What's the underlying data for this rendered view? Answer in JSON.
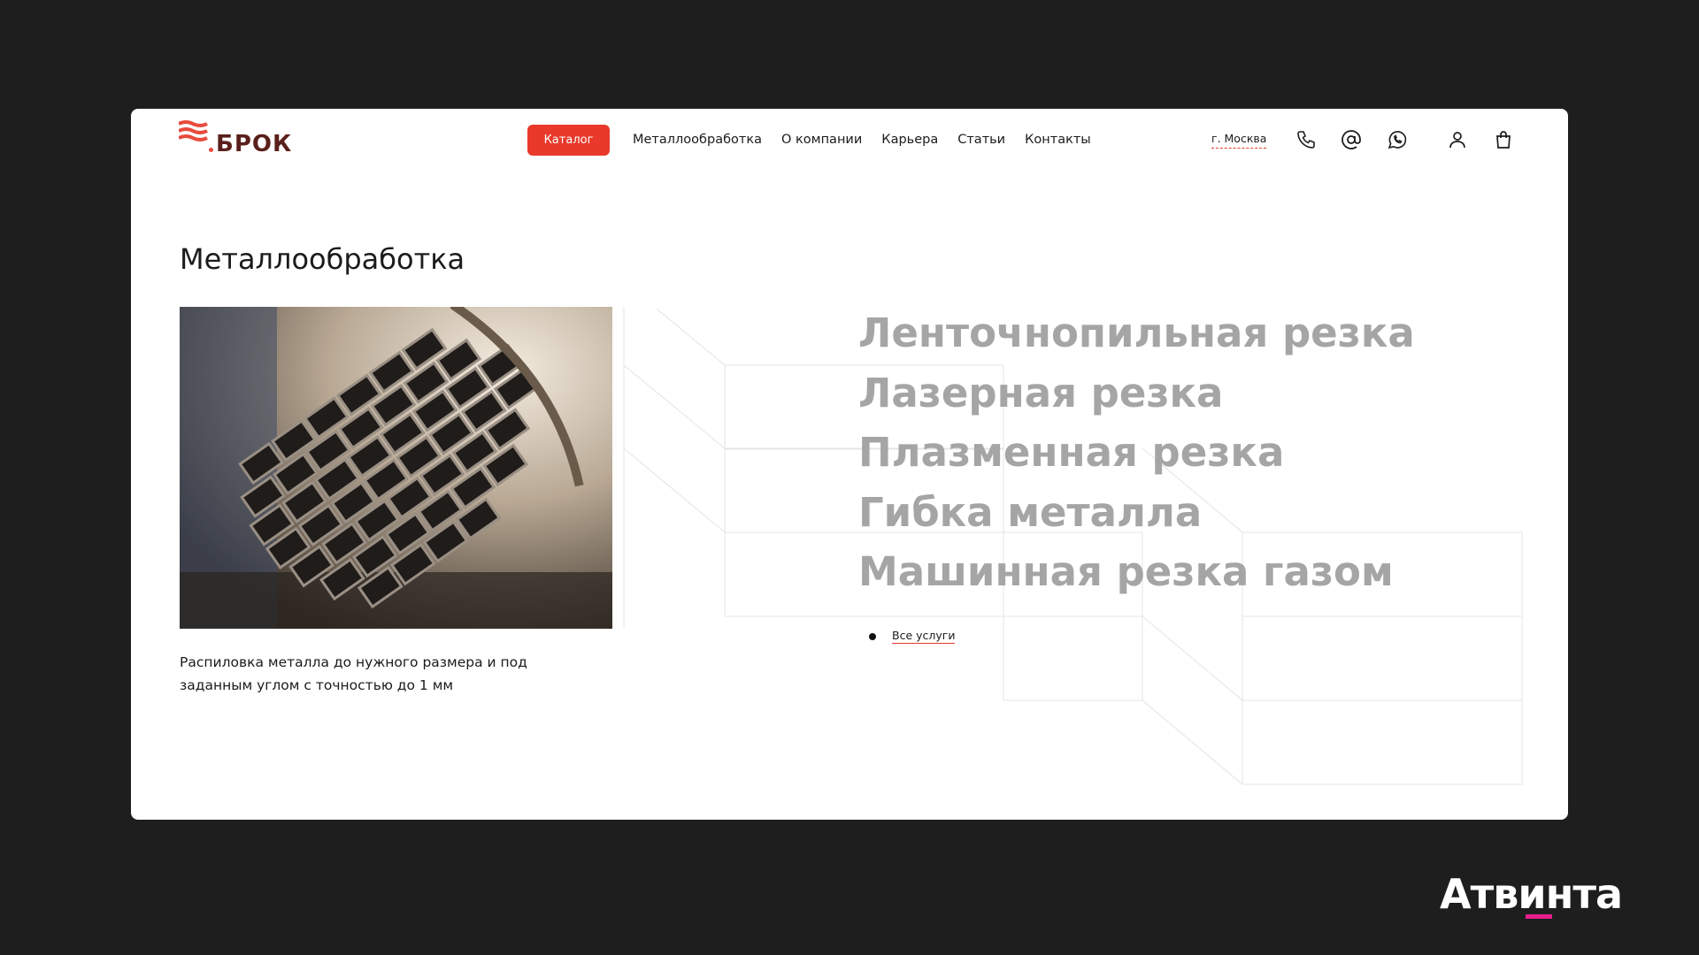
{
  "header": {
    "logo_text": "БРОК",
    "catalog_label": "Каталог",
    "nav": [
      "Металлообработка",
      "О компании",
      "Карьера",
      "Статьи",
      "Контакты"
    ],
    "city": "г. Москва",
    "icons": [
      "phone-icon",
      "email-icon",
      "whatsapp-icon",
      "user-icon",
      "cart-icon"
    ]
  },
  "main": {
    "title": "Металлообработка",
    "description": "Распиловка металла до нужного размера и под заданным углом с точностью до 1 мм",
    "services": [
      "Ленточнопильная резка",
      "Лазерная резка",
      "Плазменная резка",
      "Гибка металла",
      "Машинная резка газом"
    ],
    "all_services": "Все услуги"
  },
  "colors": {
    "accent": "#e9392b",
    "service_text": "#a5a5a5",
    "logo_dark": "#5a1f1b",
    "brand_pink": "#e91e8c"
  },
  "footer_brand": "Атвинта"
}
